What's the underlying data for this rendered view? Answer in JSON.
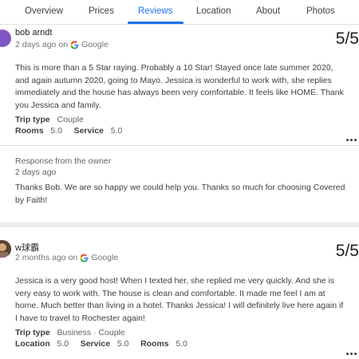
{
  "tabs": [
    {
      "label": "Overview"
    },
    {
      "label": "Prices"
    },
    {
      "label": "Reviews",
      "active": true
    },
    {
      "label": "Location"
    },
    {
      "label": "About"
    },
    {
      "label": "Photos"
    }
  ],
  "colors": {
    "accent": "#1a73e8",
    "avatar1": "#7e57c2"
  },
  "reviews": [
    {
      "author": "bob arndt",
      "avatar_icon": "avatar-purple",
      "date": "2 days ago",
      "source_prefix": "on",
      "source": "Google",
      "score": "5/5",
      "text": "This is more than a 5 Star raying. Probably a 10 Star! Stayed once late summer 2020, and again autumn 2020, going to Mayo. Jessica is wonderful to work with, she replies immediately and the house has always been very comfortable. It feels like HOME. Thank you Jessica and family.",
      "trip_type_label": "Trip type",
      "trip_type": "Couple",
      "ratings": [
        {
          "label": "Rooms",
          "value": "5.0"
        },
        {
          "label": "Service",
          "value": "5.0"
        }
      ],
      "owner_response": {
        "label": "Response from the owner",
        "date": "2 days ago",
        "text": "Thanks Bob. We are so happy we could help you. Thanks so much for choosing Covered by Faith!"
      }
    },
    {
      "author": "w球霸",
      "avatar_icon": "avatar-photo",
      "date": "2 months ago",
      "source_prefix": "on",
      "source": "Google",
      "score": "5/5",
      "text": "Jessica is a very good host! When I texted her, she replied me very quickly. And she is very easy to work with. The house is clean and comfortable. It made me feel I am at home. Much better than living in a hotel. Thanks Jessica! I will definitely live here again if I have to travel to Rochester again!",
      "trip_type_label": "Trip type",
      "trip_type": "Business · Couple",
      "ratings": [
        {
          "label": "Location",
          "value": "5.0"
        },
        {
          "label": "Service",
          "value": "5.0"
        },
        {
          "label": "Rooms",
          "value": "5.0"
        }
      ]
    }
  ]
}
